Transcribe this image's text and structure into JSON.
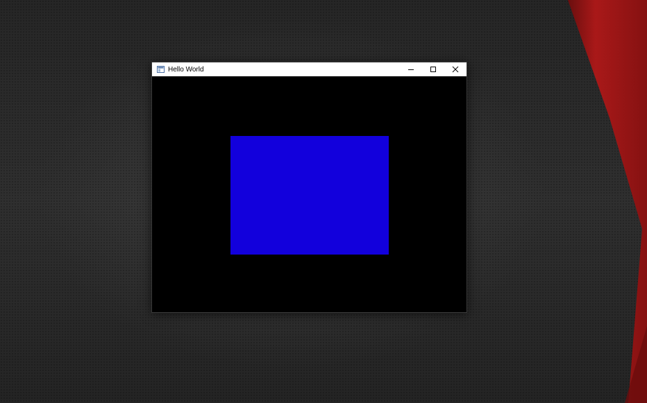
{
  "window": {
    "title": "Hello World",
    "icon": "app-window-icon",
    "controls": {
      "minimize": "minimize-icon",
      "maximize": "maximize-icon",
      "close": "close-icon"
    },
    "client_background": "#000000",
    "rectangle_color": "#1200dc"
  },
  "desktop": {
    "background": "#2a2a2a",
    "accent": "#b01818"
  }
}
